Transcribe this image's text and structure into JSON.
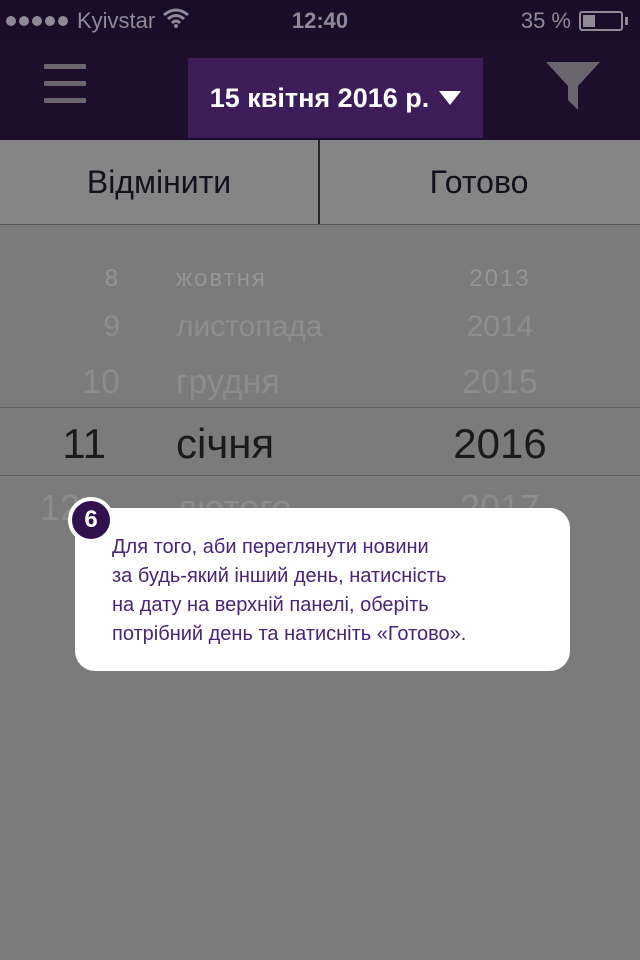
{
  "status_bar": {
    "carrier": "Kyivstar",
    "time": "12:40",
    "battery_percent": "35 %",
    "battery_level": 0.35
  },
  "nav": {
    "date_label": "15 квітня 2016 р.",
    "icons": [
      "menu-icon",
      "caret-down-icon",
      "filter-icon"
    ]
  },
  "actions": {
    "cancel_label": "Відмінити",
    "done_label": "Готово"
  },
  "picker": {
    "above_far": {
      "day": "8",
      "month": "жовтня",
      "year": "2013"
    },
    "above_2": {
      "day": "9",
      "month": "листопада",
      "year": "2014"
    },
    "above_1": {
      "day": "10",
      "month": "грудня",
      "year": "2015"
    },
    "selected": {
      "day": "11",
      "month": "січня",
      "year": "2016"
    },
    "below_1": {
      "day": "12",
      "month": "лютого",
      "year": "2017"
    }
  },
  "callout": {
    "step": "6",
    "lines": [
      "Для того, аби переглянути новини",
      "за будь-який інший день, натисність",
      "на дату на верхній панелі, оберіть",
      "потрібний день та натисніть «Готово»."
    ]
  }
}
